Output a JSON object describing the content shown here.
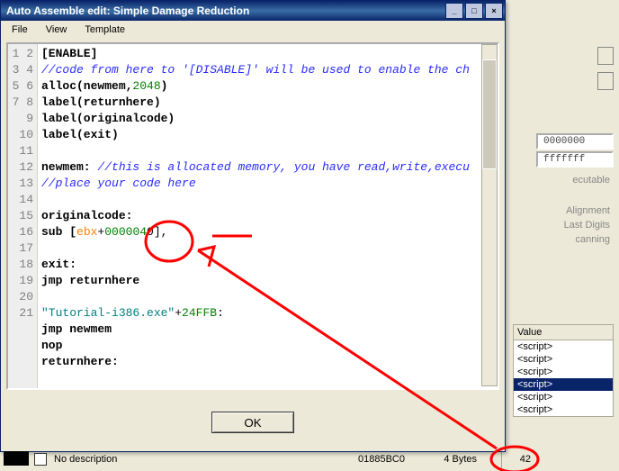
{
  "window": {
    "title": "Auto Assemble edit: Simple Damage Reduction",
    "minimize": "_",
    "maximize": "□",
    "close": "×"
  },
  "menu": {
    "file": "File",
    "view": "View",
    "template": "Template"
  },
  "code": {
    "l1": "[ENABLE]",
    "l2": "//code from here to '[DISABLE]' will be used to enable the ch",
    "l3a": "alloc(newmem,",
    "l3b": "2048",
    "l3c": ")",
    "l4": "label(returnhere)",
    "l5": "label(originalcode)",
    "l6": "label(exit)",
    "l7": "",
    "l8a": "newmem: ",
    "l8b": "//this is allocated memory, you have read,write,execu",
    "l9": "//place your code here",
    "l10": "",
    "l11": "originalcode:",
    "l12a": "sub [",
    "l12b": "ebx",
    "l12c": "+",
    "l12d": "000004",
    "l12e": "0",
    "l12f": "],",
    "l13": "",
    "l14": "exit:",
    "l15": "jmp returnhere",
    "l16": "",
    "l17a": "\"Tutorial-i386.exe\"",
    "l17b": "+",
    "l17c": "24FFB",
    "l17d": ":",
    "l18": "jmp newmem",
    "l19": "nop",
    "l20": "returnhere:",
    "l21": ""
  },
  "gut": [
    "1",
    "2",
    "3",
    "4",
    "5",
    "6",
    "7",
    "8",
    "9",
    "10",
    "11",
    "12",
    "13",
    "14",
    "15",
    "16",
    "17",
    "18",
    "19",
    "20",
    "21"
  ],
  "ok": "OK",
  "right": {
    "hex1": "0000000",
    "hex2": "fffffff",
    "cut1": "ecutable",
    "align": "Alignment",
    "last": "Last Digits",
    "scan": "canning"
  },
  "value_list": {
    "header": "Value",
    "items": [
      "<script>",
      "<script>",
      "<script>",
      "<script>",
      "<script>",
      "<script>"
    ],
    "selected_index": 3
  },
  "bottom": {
    "desc": "No description",
    "addr": "01885BC0",
    "type": "4 Bytes",
    "value": "42"
  }
}
